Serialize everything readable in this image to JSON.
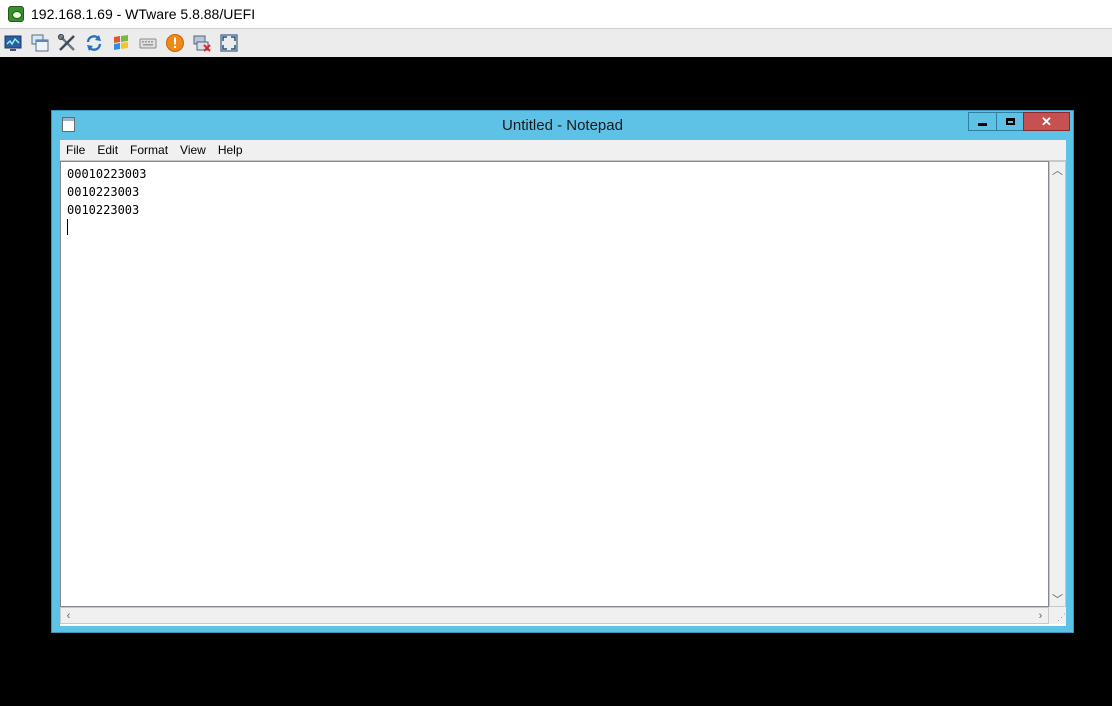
{
  "viewer": {
    "title": "192.168.1.69 - WTware 5.8.88/UEFI",
    "toolbar_icons": [
      "monitor-icon",
      "windows-cascade-icon",
      "tools-icon",
      "refresh-icon",
      "windows-logo-icon",
      "keyboard-icon",
      "warning-icon",
      "disconnect-icon",
      "fullscreen-icon"
    ]
  },
  "notepad": {
    "title": "Untitled - Notepad",
    "menu": [
      "File",
      "Edit",
      "Format",
      "View",
      "Help"
    ],
    "lines": [
      "00010223003",
      "0010223003",
      "0010223003"
    ],
    "colors": {
      "window_frame": "#5ec2e6",
      "close_button": "#c75050"
    }
  }
}
